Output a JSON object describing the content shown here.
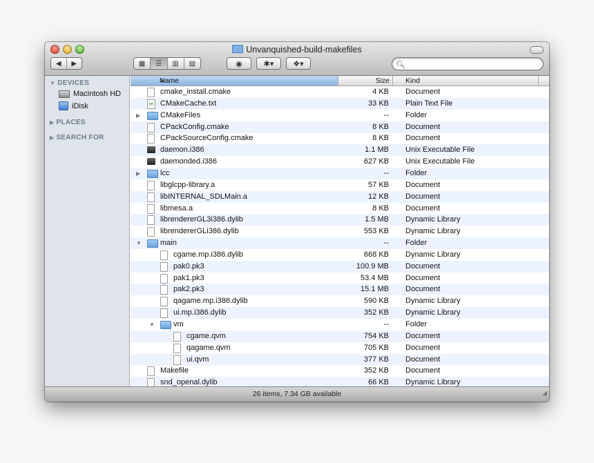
{
  "window": {
    "title": "Unvanquished-build-makefiles"
  },
  "toolbar": {
    "back_label": "◀",
    "forward_label": "▶",
    "view_icon_label": "▦",
    "view_list_label": "☰",
    "view_column_label": "▥",
    "view_coverflow_label": "▤",
    "quicklook_label": "◉",
    "action_label": "✱▾",
    "dropbox_label": "❖▾",
    "search_value": "",
    "search_placeholder": ""
  },
  "sidebar": {
    "devices_label": "DEVICES",
    "devices": [
      {
        "label": "Macintosh HD",
        "icon": "hard-drive-icon"
      },
      {
        "label": "iDisk",
        "icon": "idisk-icon"
      }
    ],
    "places_label": "PLACES",
    "search_for_label": "SEARCH FOR"
  },
  "columns": {
    "name": "Name",
    "size": "Size",
    "kind": "Kind"
  },
  "rows": [
    {
      "name": "cmake_install.cmake",
      "size": "4 KB",
      "kind": "Document",
      "icon": "doc",
      "level": 0,
      "disclosure": ""
    },
    {
      "name": "CMakeCache.txt",
      "size": "33 KB",
      "kind": "Plain Text File",
      "icon": "txt",
      "level": 0,
      "disclosure": ""
    },
    {
      "name": "CMakeFiles",
      "size": "--",
      "kind": "Folder",
      "icon": "folder",
      "level": 0,
      "disclosure": "closed"
    },
    {
      "name": "CPackConfig.cmake",
      "size": "8 KB",
      "kind": "Document",
      "icon": "doc",
      "level": 0,
      "disclosure": ""
    },
    {
      "name": "CPackSourceConfig.cmake",
      "size": "8 KB",
      "kind": "Document",
      "icon": "doc",
      "level": 0,
      "disclosure": ""
    },
    {
      "name": "daemon.i386",
      "size": "1.1 MB",
      "kind": "Unix Executable File",
      "icon": "exec",
      "level": 0,
      "disclosure": ""
    },
    {
      "name": "daemonded.i386",
      "size": "627 KB",
      "kind": "Unix Executable File",
      "icon": "exec",
      "level": 0,
      "disclosure": ""
    },
    {
      "name": "lcc",
      "size": "--",
      "kind": "Folder",
      "icon": "folder",
      "level": 0,
      "disclosure": "closed"
    },
    {
      "name": "libglcpp-library.a",
      "size": "57 KB",
      "kind": "Document",
      "icon": "doc",
      "level": 0,
      "disclosure": ""
    },
    {
      "name": "libINTERNAL_SDLMain.a",
      "size": "12 KB",
      "kind": "Document",
      "icon": "doc",
      "level": 0,
      "disclosure": ""
    },
    {
      "name": "libmesa.a",
      "size": "8 KB",
      "kind": "Document",
      "icon": "doc",
      "level": 0,
      "disclosure": ""
    },
    {
      "name": "librendererGL3i386.dylib",
      "size": "1.5 MB",
      "kind": "Dynamic Library",
      "icon": "doc",
      "level": 0,
      "disclosure": ""
    },
    {
      "name": "librendererGLi386.dylib",
      "size": "553 KB",
      "kind": "Dynamic Library",
      "icon": "doc",
      "level": 0,
      "disclosure": ""
    },
    {
      "name": "main",
      "size": "--",
      "kind": "Folder",
      "icon": "folder",
      "level": 0,
      "disclosure": "open"
    },
    {
      "name": "cgame.mp.i386.dylib",
      "size": "668 KB",
      "kind": "Dynamic Library",
      "icon": "doc",
      "level": 1,
      "disclosure": ""
    },
    {
      "name": "pak0.pk3",
      "size": "100.9 MB",
      "kind": "Document",
      "icon": "doc",
      "level": 1,
      "disclosure": ""
    },
    {
      "name": "pak1.pk3",
      "size": "53.4 MB",
      "kind": "Document",
      "icon": "doc",
      "level": 1,
      "disclosure": ""
    },
    {
      "name": "pak2.pk3",
      "size": "15.1 MB",
      "kind": "Document",
      "icon": "doc",
      "level": 1,
      "disclosure": ""
    },
    {
      "name": "qagame.mp.i386.dylib",
      "size": "590 KB",
      "kind": "Dynamic Library",
      "icon": "doc",
      "level": 1,
      "disclosure": ""
    },
    {
      "name": "ui.mp.i386.dylib",
      "size": "352 KB",
      "kind": "Dynamic Library",
      "icon": "doc",
      "level": 1,
      "disclosure": ""
    },
    {
      "name": "vm",
      "size": "--",
      "kind": "Folder",
      "icon": "folder",
      "level": 1,
      "disclosure": "open"
    },
    {
      "name": "cgame.qvm",
      "size": "754 KB",
      "kind": "Document",
      "icon": "doc",
      "level": 2,
      "disclosure": ""
    },
    {
      "name": "qagame.qvm",
      "size": "705 KB",
      "kind": "Document",
      "icon": "doc",
      "level": 2,
      "disclosure": ""
    },
    {
      "name": "ui.qvm",
      "size": "377 KB",
      "kind": "Document",
      "icon": "doc",
      "level": 2,
      "disclosure": ""
    },
    {
      "name": "Makefile",
      "size": "352 KB",
      "kind": "Document",
      "icon": "doc",
      "level": 0,
      "disclosure": ""
    },
    {
      "name": "snd_openal.dylib",
      "size": "66 KB",
      "kind": "Dynamic Library",
      "icon": "doc",
      "level": 0,
      "disclosure": ""
    }
  ],
  "status": {
    "text": "26 items, 7.34 GB available"
  },
  "colors": {
    "sidebar_bg": "#dfe4ea",
    "row_alt": "#edf3fe",
    "sort_header": "#8bb3e2"
  }
}
